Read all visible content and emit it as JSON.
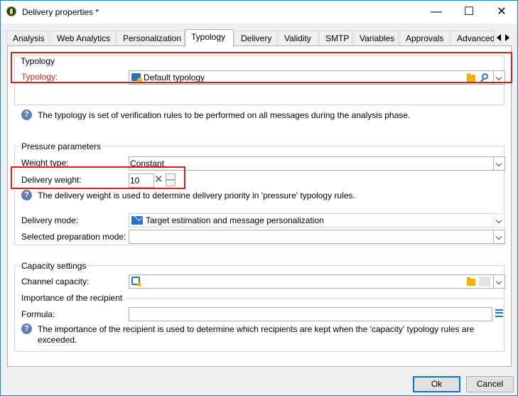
{
  "window": {
    "title": "Delivery properties *",
    "minimize": "—",
    "maximize": "☐",
    "close": "✕"
  },
  "tabs": [
    {
      "label": "Analysis"
    },
    {
      "label": "Web Analytics"
    },
    {
      "label": "Personalization"
    },
    {
      "label": "Typology",
      "active": true
    },
    {
      "label": "Delivery"
    },
    {
      "label": "Validity"
    },
    {
      "label": "SMTP"
    },
    {
      "label": "Variables"
    },
    {
      "label": "Approvals"
    },
    {
      "label": "Advanced"
    }
  ],
  "typology_section": {
    "group_title": "Typology",
    "typology_label": "Typology:",
    "typology_value": "Default typology",
    "help": "The typology is set of verification rules to be performed on all messages during the analysis phase."
  },
  "pressure_section": {
    "group_title": "Pressure parameters",
    "weight_type_label": "Weight type:",
    "weight_type_value": "Constant",
    "delivery_weight_label": "Delivery weight:",
    "delivery_weight_value": "10",
    "help": "The delivery weight is used to determine delivery priority in 'pressure' typology rules.",
    "delivery_mode_label": "Delivery mode:",
    "delivery_mode_value": "Target estimation and message personalization",
    "prep_mode_label": "Selected preparation mode:",
    "prep_mode_value": ""
  },
  "capacity_section": {
    "group_title": "Capacity settings",
    "channel_capacity_label": "Channel capacity:",
    "channel_capacity_value": "",
    "importance_title": "Importance of the recipient",
    "formula_label": "Formula:",
    "formula_value": "",
    "help_line1": "The importance of the recipient is used to determine which recipients are kept when the 'capacity' typology rules are",
    "help_line2": "exceeded."
  },
  "buttons": {
    "ok": "Ok",
    "cancel": "Cancel"
  },
  "colors": {
    "highlight_red": "#d0211c",
    "required_label_red": "#d0211c",
    "accent_blue": "#0078d7"
  }
}
